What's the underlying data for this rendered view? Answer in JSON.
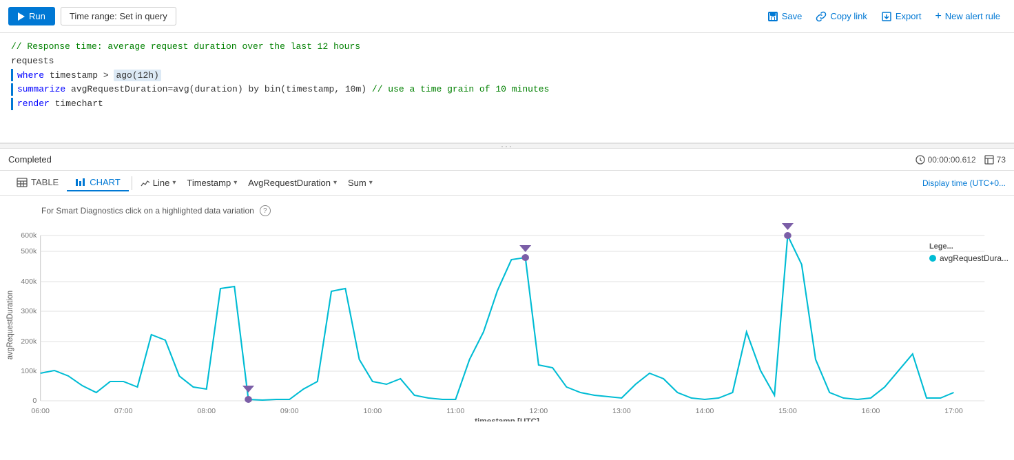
{
  "toolbar": {
    "run_label": "Run",
    "time_range_label": "Time range: Set in query",
    "save_label": "Save",
    "copy_link_label": "Copy link",
    "export_label": "Export",
    "new_alert_label": "New alert rule"
  },
  "query": {
    "comment_line": "// Response time: average request duration over the last 12 hours",
    "line1": "requests",
    "line2_keyword": "where",
    "line2_rest": " timestamp > ago(12h)",
    "line3_keyword": "summarize",
    "line3_rest": " avgRequestDuration=avg(duration) by bin(timestamp, 10m) // use a time grain of 10 minutes",
    "line4_keyword": "render",
    "line4_rest": " timechart"
  },
  "results": {
    "status": "Completed",
    "duration": "00:00:00.612",
    "row_count": "73"
  },
  "view_tabs": {
    "table_label": "TABLE",
    "chart_label": "CHART",
    "line_label": "Line",
    "timestamp_label": "Timestamp",
    "avg_label": "AvgRequestDuration",
    "sum_label": "Sum",
    "display_time": "Display time (UTC+0..."
  },
  "chart": {
    "smart_diag_text": "For Smart Diagnostics click on a highlighted data variation",
    "y_axis_label": "avgRequestDuration",
    "x_axis_label": "timestamp [UTC]",
    "y_ticks": [
      "600k",
      "500k",
      "400k",
      "300k",
      "200k",
      "100k",
      "0"
    ],
    "x_ticks": [
      "06:00",
      "07:00",
      "08:00",
      "09:00",
      "10:00",
      "11:00",
      "12:00",
      "13:00",
      "14:00",
      "15:00",
      "16:00",
      "17:00"
    ],
    "legend_label": "avgRequestDura..."
  }
}
